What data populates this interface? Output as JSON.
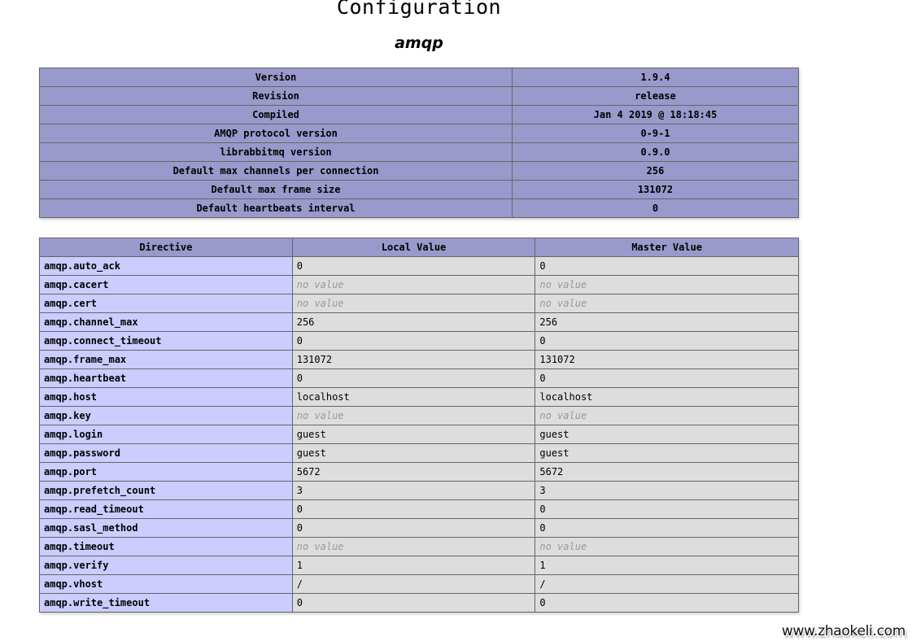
{
  "page": {
    "title": "Configuration",
    "module": "amqp"
  },
  "info_rows": [
    {
      "key": "Version",
      "value": "1.9.4"
    },
    {
      "key": "Revision",
      "value": "release"
    },
    {
      "key": "Compiled",
      "value": "Jan 4 2019 @ 18:18:45"
    },
    {
      "key": "AMQP protocol version",
      "value": "0-9-1"
    },
    {
      "key": "librabbitmq version",
      "value": "0.9.0"
    },
    {
      "key": "Default max channels per connection",
      "value": "256"
    },
    {
      "key": "Default max frame size",
      "value": "131072"
    },
    {
      "key": "Default heartbeats interval",
      "value": "0"
    }
  ],
  "directives": {
    "headers": [
      "Directive",
      "Local Value",
      "Master Value"
    ],
    "rows": [
      {
        "name": "amqp.auto_ack",
        "local": "0",
        "master": "0"
      },
      {
        "name": "amqp.cacert",
        "local": "no value",
        "master": "no value",
        "empty": true
      },
      {
        "name": "amqp.cert",
        "local": "no value",
        "master": "no value",
        "empty": true
      },
      {
        "name": "amqp.channel_max",
        "local": "256",
        "master": "256"
      },
      {
        "name": "amqp.connect_timeout",
        "local": "0",
        "master": "0"
      },
      {
        "name": "amqp.frame_max",
        "local": "131072",
        "master": "131072"
      },
      {
        "name": "amqp.heartbeat",
        "local": "0",
        "master": "0"
      },
      {
        "name": "amqp.host",
        "local": "localhost",
        "master": "localhost"
      },
      {
        "name": "amqp.key",
        "local": "no value",
        "master": "no value",
        "empty": true
      },
      {
        "name": "amqp.login",
        "local": "guest",
        "master": "guest"
      },
      {
        "name": "amqp.password",
        "local": "guest",
        "master": "guest"
      },
      {
        "name": "amqp.port",
        "local": "5672",
        "master": "5672"
      },
      {
        "name": "amqp.prefetch_count",
        "local": "3",
        "master": "3"
      },
      {
        "name": "amqp.read_timeout",
        "local": "0",
        "master": "0"
      },
      {
        "name": "amqp.sasl_method",
        "local": "0",
        "master": "0"
      },
      {
        "name": "amqp.timeout",
        "local": "no value",
        "master": "no value",
        "empty": true
      },
      {
        "name": "amqp.verify",
        "local": "1",
        "master": "1"
      },
      {
        "name": "amqp.vhost",
        "local": "/",
        "master": "/"
      },
      {
        "name": "amqp.write_timeout",
        "local": "0",
        "master": "0"
      }
    ]
  },
  "watermark": "www.zhaokeli.com",
  "colors": {
    "header_bg": "#9999cc",
    "directive_bg": "#ccccff",
    "value_bg": "#dddddd",
    "no_value": "#999999"
  }
}
